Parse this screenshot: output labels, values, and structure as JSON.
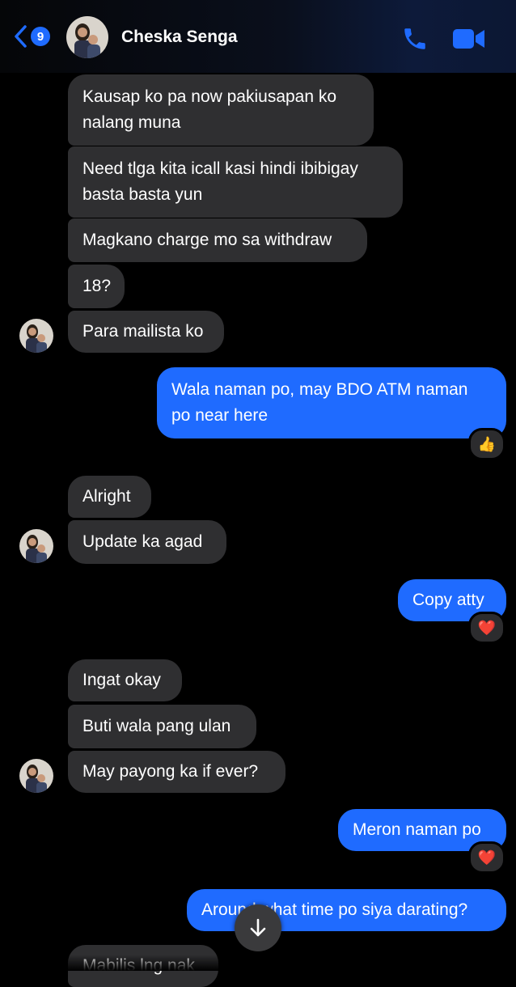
{
  "header": {
    "back_count": "9",
    "contact_name": "Cheska Senga",
    "icons": {
      "back": "chevron-left-icon",
      "phone": "phone-icon",
      "video": "video-camera-icon"
    },
    "accent": "#1f6bff"
  },
  "messages": [
    {
      "id": "m1",
      "direction": "incoming",
      "lines": [
        "Kausap ko pa now pakiusapan ko",
        "nalang muna"
      ]
    },
    {
      "id": "m2",
      "direction": "incoming",
      "lines": [
        "Need tlga kita icall kasi hindi ibibigay",
        "basta basta yun"
      ]
    },
    {
      "id": "m3",
      "direction": "incoming",
      "lines": [
        "Magkano charge mo sa withdraw"
      ]
    },
    {
      "id": "m4",
      "direction": "incoming",
      "lines": [
        "18?"
      ]
    },
    {
      "id": "m5",
      "direction": "incoming",
      "lines": [
        "Para mailista ko"
      ]
    },
    {
      "id": "m6",
      "direction": "outgoing",
      "lines": [
        "Wala naman po, may BDO ATM naman",
        "po near here"
      ],
      "reaction": "👍"
    },
    {
      "id": "m7",
      "direction": "incoming",
      "lines": [
        "Alright"
      ]
    },
    {
      "id": "m8",
      "direction": "incoming",
      "lines": [
        "Update ka agad"
      ]
    },
    {
      "id": "m9",
      "direction": "outgoing",
      "lines": [
        "Copy atty"
      ],
      "reaction": "❤️"
    },
    {
      "id": "m10",
      "direction": "incoming",
      "lines": [
        "Ingat okay"
      ]
    },
    {
      "id": "m11",
      "direction": "incoming",
      "lines": [
        "Buti wala pang ulan"
      ]
    },
    {
      "id": "m12",
      "direction": "incoming",
      "lines": [
        "May payong ka if ever?"
      ]
    },
    {
      "id": "m13",
      "direction": "outgoing",
      "lines": [
        "Meron naman po"
      ],
      "reaction": "❤️"
    },
    {
      "id": "m14",
      "direction": "outgoing",
      "lines": [
        "Around what time po siya darating?"
      ]
    },
    {
      "id": "m15",
      "direction": "incoming",
      "lines": [
        "Mabilis lng nak"
      ]
    }
  ],
  "scroll_button": {
    "icon": "arrow-down-icon"
  },
  "colors": {
    "incoming_bubble": "#2f2f31",
    "outgoing_bubble": "#1f6bff",
    "background": "#000000"
  }
}
